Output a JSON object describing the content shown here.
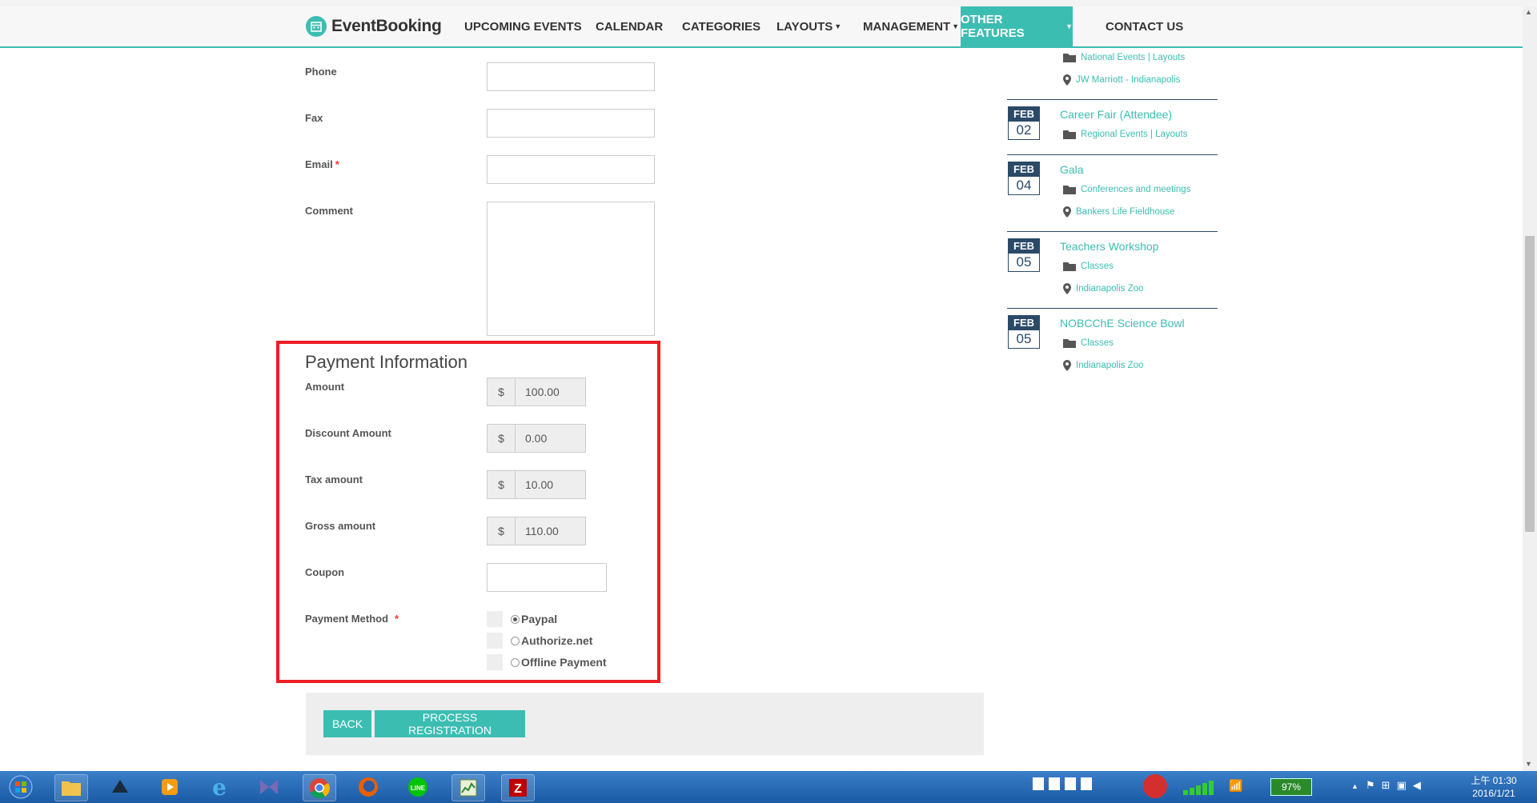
{
  "nav": {
    "logo_text": "EventBooking",
    "items": [
      {
        "label": "UPCOMING EVENTS",
        "has_caret": false
      },
      {
        "label": "CALENDAR",
        "has_caret": false
      },
      {
        "label": "CATEGORIES",
        "has_caret": false
      },
      {
        "label": "LAYOUTS",
        "has_caret": true
      },
      {
        "label": "MANAGEMENT",
        "has_caret": true
      },
      {
        "label": "OTHER FEATURES",
        "has_caret": true,
        "active": true
      },
      {
        "label": "CONTACT US",
        "has_caret": false
      }
    ],
    "active_color": "#3cbdb2"
  },
  "form": {
    "phone_label": "Phone",
    "fax_label": "Fax",
    "email_label": "Email",
    "required_mark": "*",
    "comment_label": "Comment",
    "phone_value": "",
    "fax_value": "",
    "email_value": "",
    "comment_value": ""
  },
  "payment": {
    "title": "Payment Information",
    "currency_symbol": "$",
    "amount_label": "Amount",
    "amount_value": "100.00",
    "discount_label": "Discount Amount",
    "discount_value": "0.00",
    "tax_label": "Tax amount",
    "tax_value": "10.00",
    "gross_label": "Gross amount",
    "gross_value": "110.00",
    "coupon_label": "Coupon",
    "coupon_value": "",
    "method_label": "Payment Method",
    "method_required": "*",
    "methods": [
      {
        "label": "Paypal",
        "checked": true
      },
      {
        "label": "Authorize.net",
        "checked": false
      },
      {
        "label": "Offline Payment",
        "checked": false
      }
    ],
    "highlight_color": "#ee1c25"
  },
  "actions": {
    "back_label": "BACK",
    "process_label": "PROCESS REGISTRATION"
  },
  "sidebar": {
    "top_partial": {
      "category": "National Events | Layouts",
      "location": "JW Marriott - Indianapolis"
    },
    "events": [
      {
        "month": "FEB",
        "day": "02",
        "title": "Career Fair (Attendee)",
        "category": "Regional Events | Layouts",
        "location": ""
      },
      {
        "month": "FEB",
        "day": "04",
        "title": "Gala",
        "category": "Conferences and meetings",
        "location": "Bankers Life Fieldhouse"
      },
      {
        "month": "FEB",
        "day": "05",
        "title": "Teachers Workshop",
        "category": "Classes",
        "location": "Indianapolis Zoo"
      },
      {
        "month": "FEB",
        "day": "05",
        "title": "NOBCChE Science Bowl",
        "category": "Classes",
        "location": "Indianapolis Zoo"
      }
    ]
  },
  "taskbar": {
    "icons": [
      "start-orb-icon",
      "explorer-icon",
      "app-icon",
      "media-player-icon",
      "internet-explorer-icon",
      "visual-studio-icon",
      "chrome-icon",
      "firefox-icon",
      "line-icon",
      "taskmgr-icon",
      "filezilla-icon"
    ],
    "battery": "97%",
    "time": "上午 01:30",
    "date": "2016/1/21"
  }
}
